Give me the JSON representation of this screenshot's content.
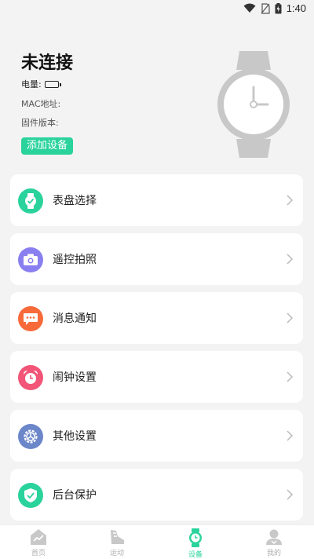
{
  "status": {
    "time": "1:40"
  },
  "device": {
    "title": "未连接",
    "power_label": "电量:",
    "mac_label": "MAC地址:",
    "firmware_label": "固件版本:",
    "add_button": "添加设备"
  },
  "menu": [
    {
      "label": "表盘选择",
      "icon": "watch-face-icon",
      "color": "#2bd39c"
    },
    {
      "label": "遥控拍照",
      "icon": "camera-icon",
      "color": "#8a7ff0"
    },
    {
      "label": "消息通知",
      "icon": "message-icon",
      "color": "#f86a3a"
    },
    {
      "label": "闹钟设置",
      "icon": "alarm-icon",
      "color": "#f25577"
    },
    {
      "label": "其他设置",
      "icon": "gear-icon",
      "color": "#6b86c9"
    },
    {
      "label": "后台保护",
      "icon": "shield-icon",
      "color": "#2bd39c"
    }
  ],
  "tabs": [
    {
      "label": "首页",
      "icon": "home-chart-icon"
    },
    {
      "label": "运动",
      "icon": "shoe-icon"
    },
    {
      "label": "设备",
      "icon": "watch-icon",
      "active": true
    },
    {
      "label": "我的",
      "icon": "user-icon"
    }
  ],
  "colors": {
    "accent": "#2bd39c",
    "background": "#f3f3f3",
    "watch_gray": "#c8c8c8"
  }
}
